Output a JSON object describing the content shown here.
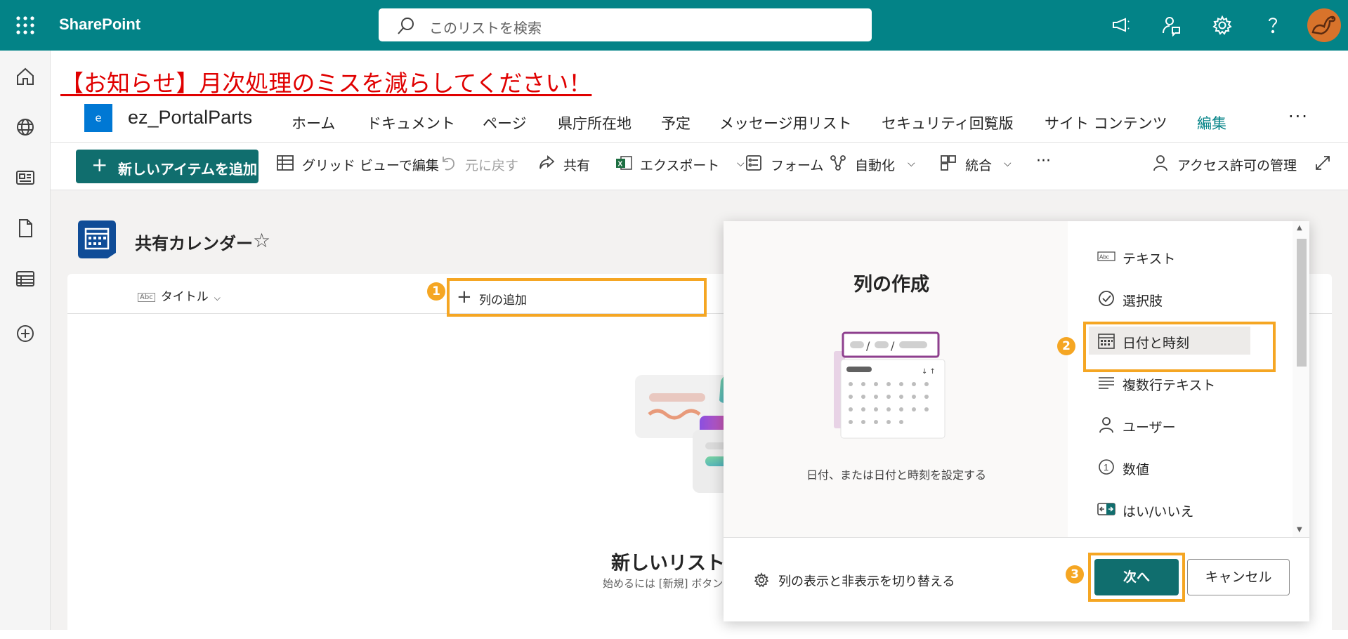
{
  "suitebar": {
    "app_name": "SharePoint",
    "search_placeholder": "このリストを検索",
    "icons": [
      "waffle-icon",
      "megaphone-icon",
      "feedback-icon",
      "settings-icon",
      "help-icon",
      "avatar"
    ],
    "colors": {
      "bar": "#038387"
    }
  },
  "leftrail": {
    "icons": [
      "home-icon",
      "globe-icon",
      "news-icon",
      "document-icon",
      "list-icon",
      "add-icon"
    ]
  },
  "notice": "【お知らせ】月次処理のミスを減らしてください！",
  "site": {
    "logo_letter": "e",
    "name": "ez_PortalParts",
    "nav": [
      "ホーム",
      "ドキュメント",
      "ページ",
      "県庁所在地",
      "予定",
      "メッセージ用リスト",
      "セキュリティ回覧版",
      "サイト コンテンツ",
      "編集"
    ],
    "more": "···"
  },
  "commandbar": {
    "new_item": "新しいアイテムを追加",
    "grid_view": "グリッド ビューで編集",
    "undo": "元に戻す",
    "share": "共有",
    "export": "エクスポート",
    "forms": "フォーム",
    "automate": "自動化",
    "integrate": "統合",
    "more": "···",
    "access": "アクセス許可の管理"
  },
  "list": {
    "title": "共有カレンダー",
    "column_title": "タイトル",
    "add_column": "列の追加",
    "empty_title": "新しいリストへ",
    "empty_sub": "始めるには [新規] ボタン"
  },
  "steps": [
    "1",
    "2",
    "3"
  ],
  "panel": {
    "heading": "列の作成",
    "description": "日付、または日付と時刻を設定する",
    "types": [
      {
        "label": "テキスト",
        "icon": "text-abc-icon"
      },
      {
        "label": "選択肢",
        "icon": "choice-check-icon"
      },
      {
        "label": "日付と時刻",
        "icon": "calendar-icon",
        "selected": true
      },
      {
        "label": "複数行テキスト",
        "icon": "multiline-text-icon"
      },
      {
        "label": "ユーザー",
        "icon": "person-icon"
      },
      {
        "label": "数値",
        "icon": "number-icon"
      },
      {
        "label": "はい/いいえ",
        "icon": "yes-no-icon"
      }
    ],
    "show_hide": "列の表示と非表示を切り替える",
    "next": "次へ",
    "cancel": "キャンセル"
  },
  "highlight_color": "#f5a623"
}
